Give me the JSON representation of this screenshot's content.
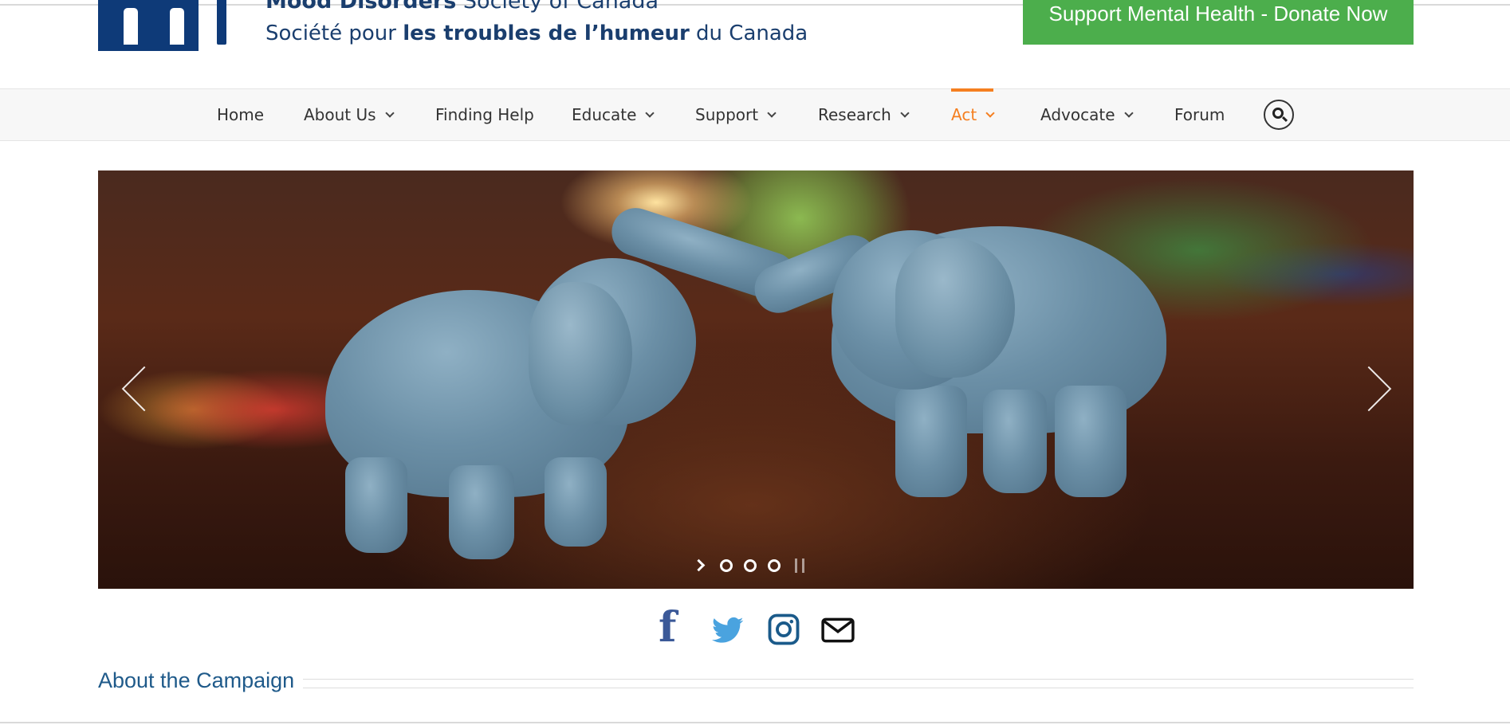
{
  "header": {
    "org_en_bold": "Mood Disorders",
    "org_en_light": "Society of Canada",
    "org_fr_light_1": "Société pour",
    "org_fr_bold": "les troubles de l’humeur",
    "org_fr_light_2": "du Canada",
    "donate_label": "Support Mental Health - Donate Now"
  },
  "nav": {
    "items": [
      {
        "label": "Home",
        "has_dropdown": false
      },
      {
        "label": "About Us",
        "has_dropdown": true
      },
      {
        "label": "Finding Help",
        "has_dropdown": false
      },
      {
        "label": "Educate",
        "has_dropdown": true
      },
      {
        "label": "Support",
        "has_dropdown": true
      },
      {
        "label": "Research",
        "has_dropdown": true
      },
      {
        "label": "Act",
        "has_dropdown": true,
        "active": true
      },
      {
        "label": "Advocate",
        "has_dropdown": true
      },
      {
        "label": "Forum",
        "has_dropdown": false
      }
    ],
    "search_icon": "search-icon",
    "active_color": "#f57f20"
  },
  "slider": {
    "slide_count": 3,
    "controls": [
      "chevron-right-icon",
      "dot",
      "dot",
      "dot",
      "pause-icon"
    ]
  },
  "social": {
    "icons": [
      "facebook-icon",
      "twitter-icon",
      "instagram-icon",
      "mail-icon"
    ],
    "colors": {
      "facebook": "#3b5998",
      "twitter": "#4aa3df",
      "instagram": "#1a5a8a",
      "mail": "#111111"
    }
  },
  "section": {
    "title": "About the Campaign"
  },
  "colors": {
    "brand_navy": "#0e3a78",
    "donate_green": "#4cae4c",
    "link_blue": "#1f5a8a"
  }
}
